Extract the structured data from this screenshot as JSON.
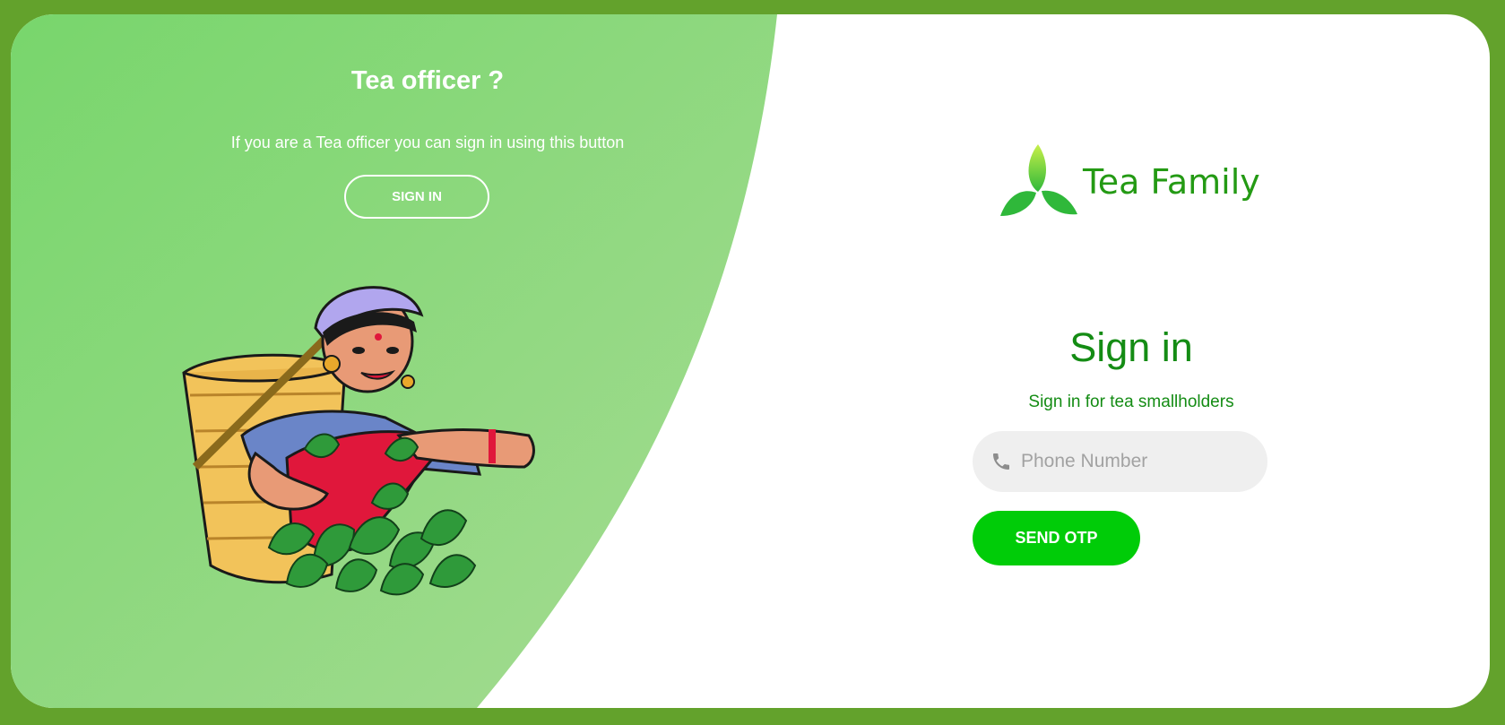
{
  "colors": {
    "frame": "#63a22c",
    "panel_gradient_start": "#78d66c",
    "panel_gradient_end": "#a4db91",
    "brand_green": "#249a14",
    "heading_green": "#148c14",
    "button_green": "#00cc08"
  },
  "officer_panel": {
    "title": "Tea officer ?",
    "subtitle": "If you are a Tea officer you can sign in using this button",
    "button_label": "SIGN IN"
  },
  "brand": {
    "name": "Tea Family",
    "icon": "tea-leaves-icon"
  },
  "signin": {
    "title": "Sign in",
    "subtitle": "Sign in for tea smallholders",
    "phone": {
      "icon": "phone-icon",
      "placeholder": "Phone Number",
      "value": ""
    },
    "submit_label": "SEND OTP"
  }
}
